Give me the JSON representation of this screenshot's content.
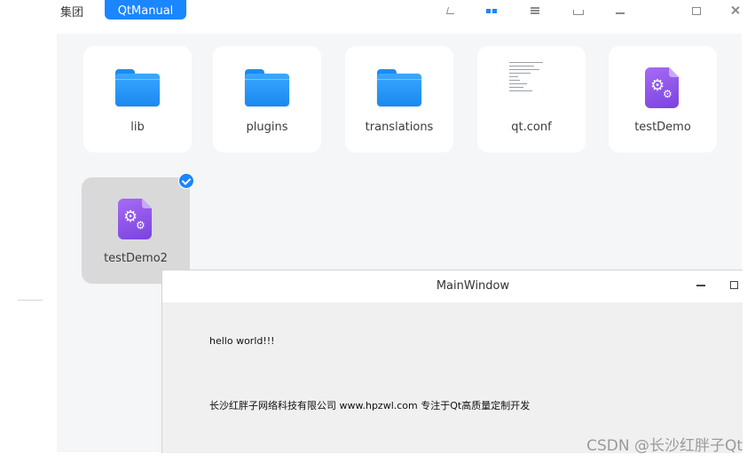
{
  "toolbar": {
    "tab_label": "集团",
    "path_button": "QtManual"
  },
  "files": [
    {
      "name": "lib",
      "type": "folder"
    },
    {
      "name": "plugins",
      "type": "folder"
    },
    {
      "name": "translations",
      "type": "folder"
    },
    {
      "name": "qt.conf",
      "type": "text"
    },
    {
      "name": "testDemo",
      "type": "executable"
    },
    {
      "name": "testDemo2",
      "type": "executable",
      "selected": true
    }
  ],
  "main_window": {
    "title": "MainWindow",
    "hello_text": "hello world!!!",
    "company_text": "长沙红胖子网络科技有限公司 www.hpzwl.com 专注于Qt高质量定制开发"
  },
  "watermark": "CSDN @长沙红胖子Qt",
  "colors": {
    "accent": "#1a86ff",
    "folder": "#2196f3",
    "executable": "#8b55ea",
    "selected_tile": "#d9d9d9"
  }
}
